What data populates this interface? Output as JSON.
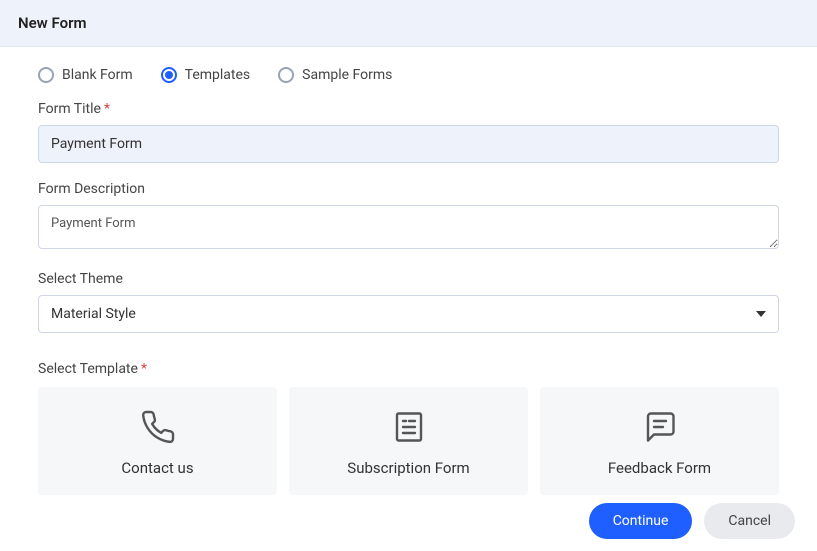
{
  "header": {
    "title": "New Form"
  },
  "mode": {
    "options": [
      {
        "label": "Blank Form",
        "selected": false
      },
      {
        "label": "Templates",
        "selected": true
      },
      {
        "label": "Sample Forms",
        "selected": false
      }
    ]
  },
  "fields": {
    "title_label": "Form Title",
    "title_value": "Payment Form",
    "description_label": "Form Description",
    "description_value": "Payment Form",
    "theme_label": "Select Theme",
    "theme_value": "Material Style",
    "template_label": "Select Template"
  },
  "templates": [
    {
      "name": "Contact us",
      "icon": "phone"
    },
    {
      "name": "Subscription Form",
      "icon": "document"
    },
    {
      "name": "Feedback Form",
      "icon": "chat"
    }
  ],
  "footer": {
    "continue_label": "Continue",
    "cancel_label": "Cancel"
  },
  "required_mark": "*"
}
